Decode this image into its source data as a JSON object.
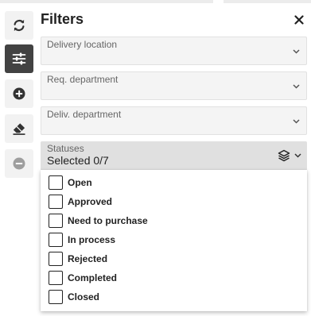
{
  "panel": {
    "title": "Filters"
  },
  "toolbar": {
    "tools": [
      {
        "icon": "refresh-icon",
        "active": false
      },
      {
        "icon": "sliders-icon",
        "active": true
      },
      {
        "icon": "add-circle-icon",
        "active": false
      },
      {
        "icon": "eraser-icon",
        "active": false
      },
      {
        "icon": "remove-circle-icon",
        "active": false
      }
    ]
  },
  "fields": {
    "delivery_location": {
      "label": "Delivery location"
    },
    "req_department": {
      "label": "Req. department"
    },
    "deliv_department": {
      "label": "Deliv. department"
    }
  },
  "statuses": {
    "label": "Statuses",
    "value": "Selected 0/7",
    "options": [
      {
        "label": "Open",
        "checked": false
      },
      {
        "label": "Approved",
        "checked": false
      },
      {
        "label": "Need to purchase",
        "checked": false
      },
      {
        "label": "In process",
        "checked": false
      },
      {
        "label": "Rejected",
        "checked": false
      },
      {
        "label": "Completed",
        "checked": false
      },
      {
        "label": "Closed",
        "checked": false
      }
    ]
  },
  "colors": {
    "active_tool_bg": "#424242",
    "tool_bg": "#f2f2f2",
    "field_bg": "#f4f4f4",
    "open_field_bg": "#e0e0e0"
  }
}
